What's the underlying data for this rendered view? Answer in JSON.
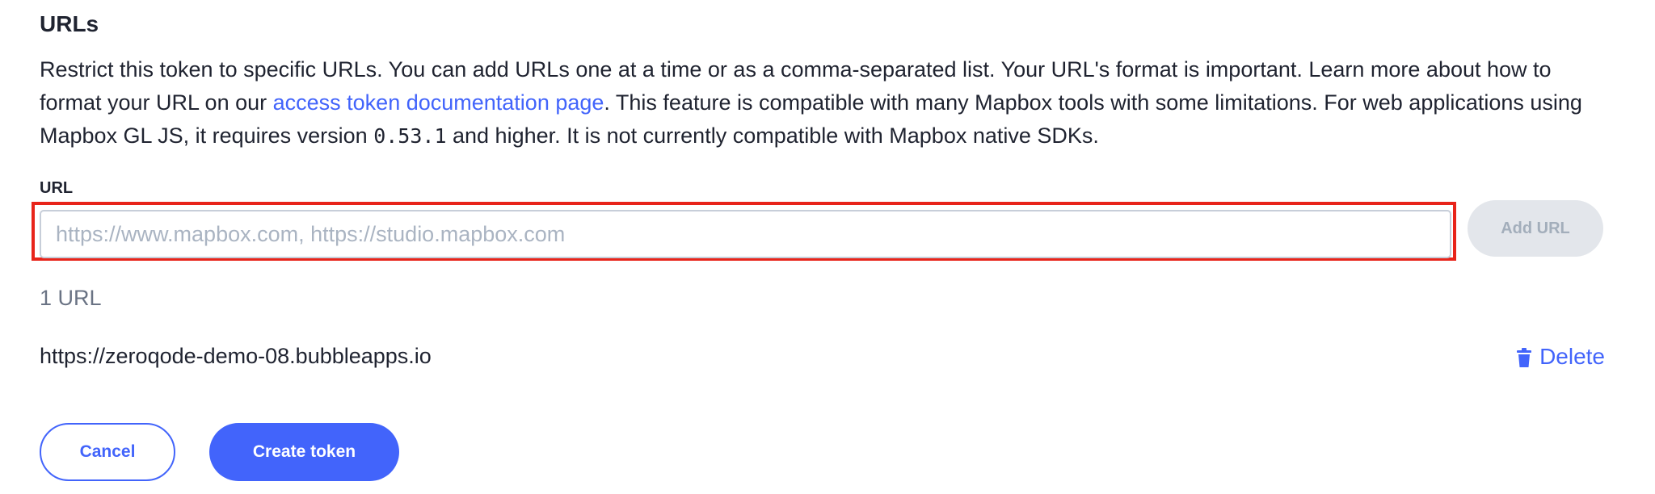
{
  "section": {
    "title": "URLs",
    "description": {
      "part1": "Restrict this token to specific URLs. You can add URLs one at a time or as a comma-separated list. Your URL's format is important. Learn more about how to format your URL on our ",
      "link_text": "access token documentation page",
      "part2": ". This feature is compatible with many Mapbox tools with some limitations. For web applications using Mapbox GL JS, it requires version ",
      "version": "0.53.1",
      "part3": " and higher. It is not currently compatible with Mapbox native SDKs."
    }
  },
  "url_field": {
    "label": "URL",
    "value": "",
    "placeholder": "https://www.mapbox.com, https://studio.mapbox.com",
    "add_button_label": "Add URL"
  },
  "url_list": {
    "count_label": "1 URL",
    "items": [
      {
        "url": "https://zeroqode-demo-08.bubbleapps.io",
        "delete_label": "Delete",
        "icon": "trash-icon"
      }
    ]
  },
  "actions": {
    "cancel_label": "Cancel",
    "create_label": "Create token"
  },
  "colors": {
    "accent": "#4264fb",
    "highlight": "#e8241a",
    "disabled_bg": "#e3e6eb"
  }
}
